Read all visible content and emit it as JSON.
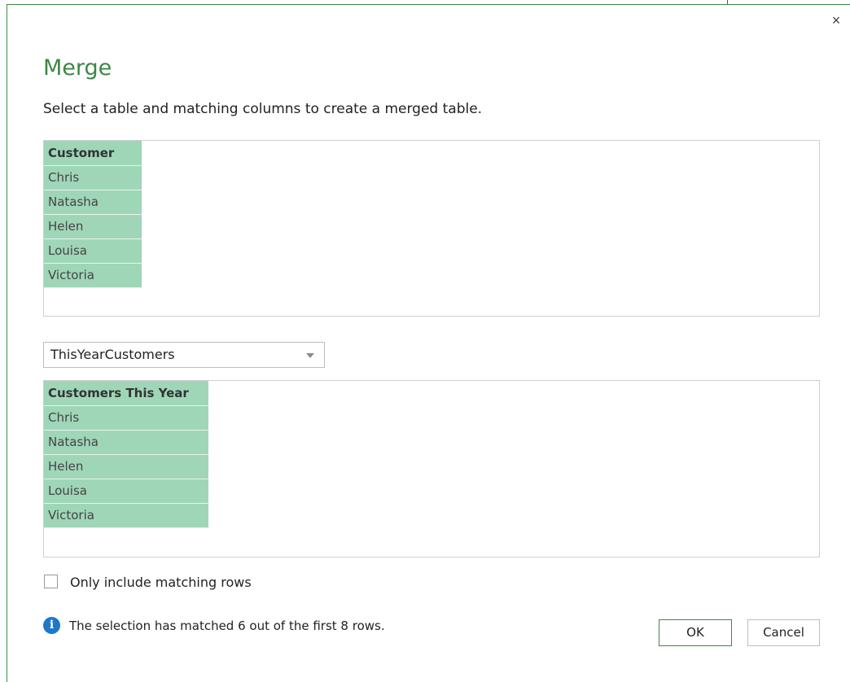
{
  "dialog": {
    "title": "Merge",
    "subtitle": "Select a table and matching columns to create a merged table.",
    "close_glyph": "×"
  },
  "table1": {
    "header": "Customer",
    "rows": [
      "Chris",
      "Natasha",
      "Helen",
      "Louisa",
      "Victoria"
    ]
  },
  "selector": {
    "selected": "ThisYearCustomers"
  },
  "table2": {
    "header": "Customers This Year",
    "rows": [
      "Chris",
      "Natasha",
      "Helen",
      "Louisa",
      "Victoria"
    ]
  },
  "options": {
    "only_matching_label": "Only include matching rows",
    "only_matching_checked": false
  },
  "status": {
    "info_glyph": "i",
    "message": "The selection has matched 6 out of the first 8 rows."
  },
  "buttons": {
    "ok_label": "OK",
    "cancel_label": "Cancel"
  },
  "colors": {
    "title_green": "#3d8746",
    "grid_green": "#9fd6b8",
    "info_blue": "#1e78c8"
  },
  "icons": [
    "close-icon",
    "chevron-down-icon",
    "info-icon",
    "checkbox-icon"
  ]
}
